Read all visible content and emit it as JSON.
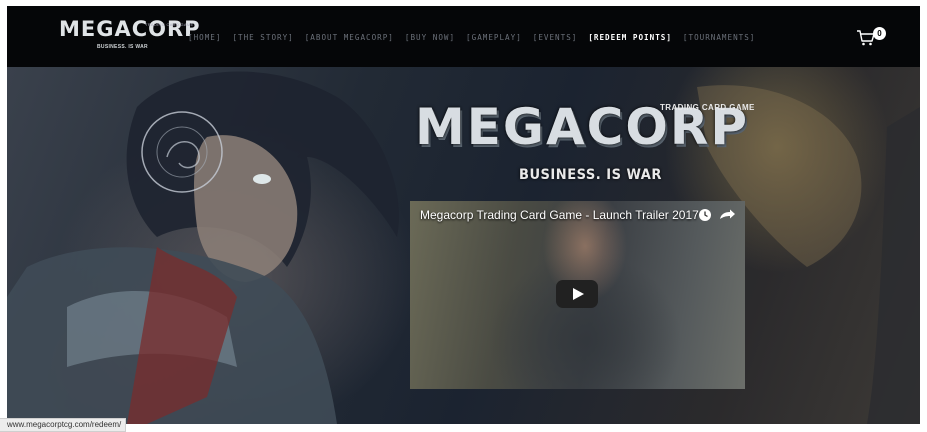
{
  "header": {
    "logo_text": "MEGACORP",
    "logo_tagline": "BUSINESS. IS WAR",
    "logo_small_caption": "TRADING CARD GAME",
    "nav": [
      {
        "label": "[HOME]",
        "active": false
      },
      {
        "label": "[THE STORY]",
        "active": false
      },
      {
        "label": "[ABOUT MEGACORP]",
        "active": false
      },
      {
        "label": "[BUY NOW]",
        "active": false
      },
      {
        "label": "[GAMEPLAY]",
        "active": false
      },
      {
        "label": "[EVENTS]",
        "active": false
      },
      {
        "label": "[REDEEM POINTS]",
        "active": true
      },
      {
        "label": "[TOURNAMENTS]",
        "active": false
      }
    ],
    "cart_count": "0"
  },
  "hero": {
    "title": "MEGACORP",
    "title_caption": "TRADING CARD GAME",
    "tagline": "BUSINESS. IS WAR"
  },
  "video": {
    "title": "Megacorp Trading Card Game - Launch Trailer 2017",
    "icons": [
      "clock-icon",
      "share-icon",
      "play-icon"
    ]
  },
  "status_bar": {
    "url": "www.megacorptcg.com/redeem/"
  },
  "colors": {
    "nav_bg": "#050608",
    "nav_text": "#6b7079",
    "nav_active": "#ffffff",
    "play_button": "#212121"
  }
}
